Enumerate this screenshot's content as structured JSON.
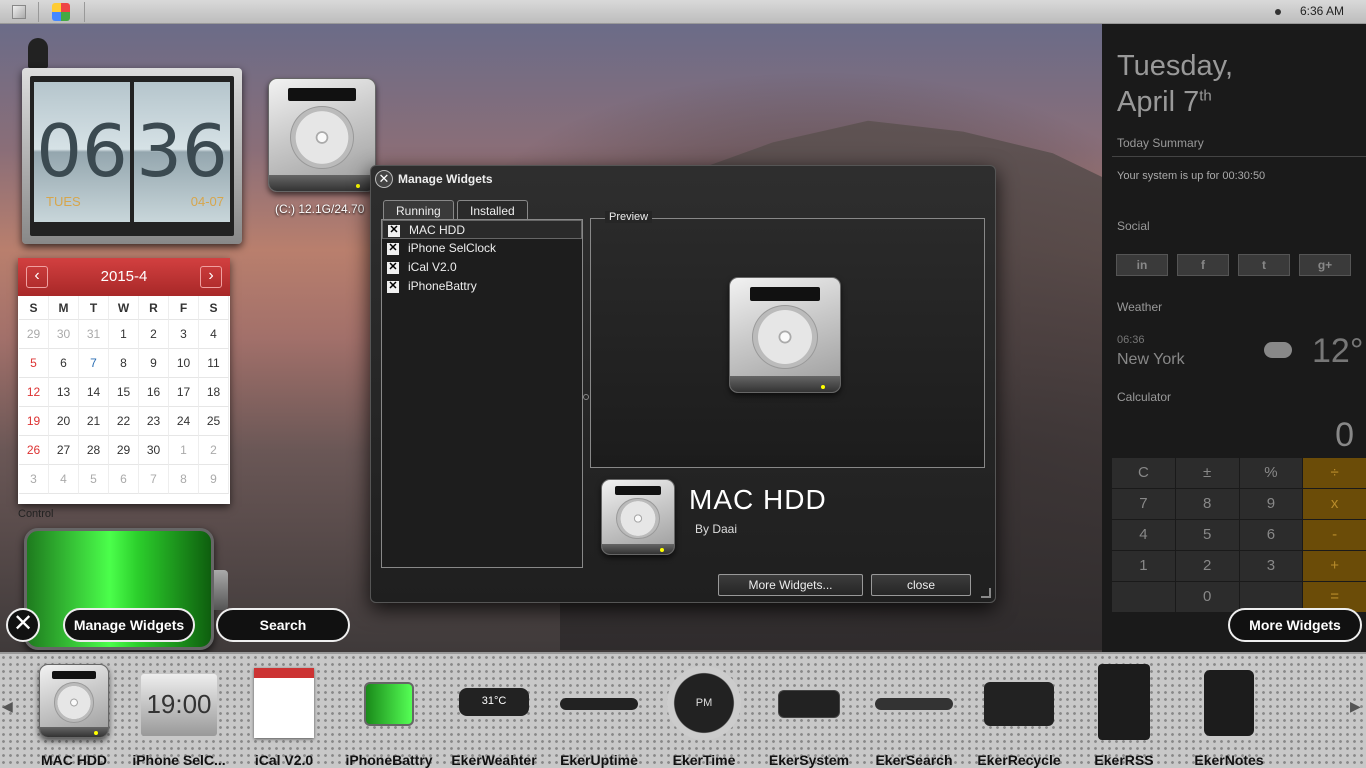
{
  "topbar": {
    "time": "6:36 AM"
  },
  "clock": {
    "hour": "06",
    "minute": "36",
    "day": "TUES",
    "date": "04-07"
  },
  "desktop_drive": {
    "label": "(C:)  12.1G/24.70"
  },
  "calendar": {
    "title": "2015-4",
    "prev": "‹",
    "next": "›",
    "weekdays": [
      "S",
      "M",
      "T",
      "W",
      "R",
      "F",
      "S"
    ],
    "weeks": [
      [
        "29",
        "30",
        "31",
        "1",
        "2",
        "3",
        "4"
      ],
      [
        "5",
        "6",
        "7",
        "8",
        "9",
        "10",
        "11"
      ],
      [
        "12",
        "13",
        "14",
        "15",
        "16",
        "17",
        "18"
      ],
      [
        "19",
        "20",
        "21",
        "22",
        "23",
        "24",
        "25"
      ],
      [
        "26",
        "27",
        "28",
        "29",
        "30",
        "1",
        "2"
      ],
      [
        "3",
        "4",
        "5",
        "6",
        "7",
        "8",
        "9"
      ]
    ]
  },
  "control_text": "Control",
  "dialog": {
    "title": "Manage Widgets",
    "tabs": [
      "Running",
      "Installed"
    ],
    "running": [
      "MAC HDD",
      "iPhone SelClock",
      "iCal V2.0",
      "iPhoneBattry"
    ],
    "check_mark": "✕",
    "preview_label": "Preview",
    "widget_name": "MAC HDD",
    "widget_author": "By Daai",
    "more_button": "More Widgets...",
    "close_button": "close"
  },
  "sidebar": {
    "day": "Tuesday,",
    "date": "April 7",
    "date_suffix": "th",
    "summary_title": "Today Summary",
    "uptime": "Your system is up for 00:30:50",
    "social_title": "Social",
    "social": [
      "in",
      "f",
      "t",
      "g+"
    ],
    "weather_title": "Weather",
    "weather_time": "06:36",
    "weather_city": "New York",
    "weather_temp": "12°",
    "calculator_title": "Calculator",
    "calc_display": "0",
    "calc_keys": [
      "C",
      "±",
      "%",
      "÷",
      "7",
      "8",
      "9",
      "x",
      "4",
      "5",
      "6",
      "-",
      "1",
      "2",
      "3",
      "+",
      "",
      "0",
      "",
      "="
    ]
  },
  "actions": {
    "close": "✕",
    "manage": "Manage Widgets",
    "search": "Search",
    "more": "More Widgets"
  },
  "tray": {
    "left_arrow": "◀",
    "right_arrow": "▶",
    "items": [
      "MAC HDD",
      "iPhone SelC...",
      "iCal V2.0",
      "iPhoneBattry",
      "EkerWeahter",
      "EkerUptime",
      "EkerTime",
      "EkerSystem",
      "EkerSearch",
      "EkerRecycle",
      "EkerRSS",
      "EkerNotes"
    ],
    "clock_thumb": "19:00",
    "weather_thumb": "31°C",
    "time_thumb": "PM"
  }
}
